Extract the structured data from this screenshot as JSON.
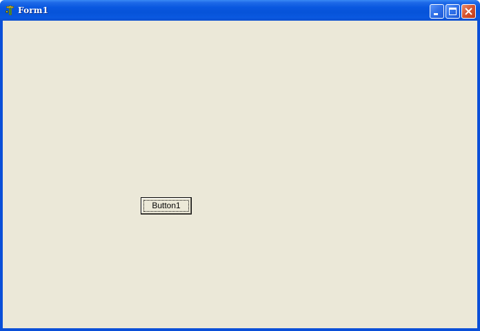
{
  "window": {
    "title": "Form1",
    "icon": "delphi-app-icon",
    "title_color": "#ffffff",
    "titlebar_color": "#0a58e0",
    "client_color": "#ebe8d8"
  },
  "caption_buttons": {
    "minimize": "minimize-icon",
    "maximize": "maximize-icon",
    "close": "close-icon"
  },
  "form": {
    "button1_label": "Button1"
  }
}
